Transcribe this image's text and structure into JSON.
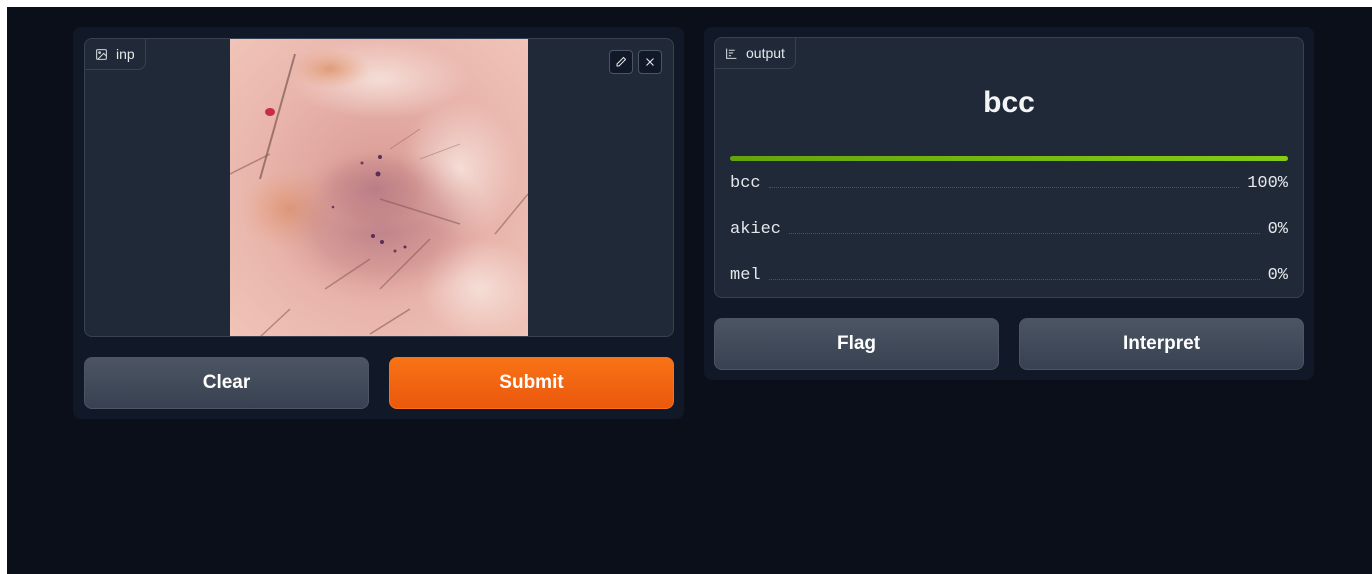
{
  "input_panel": {
    "label": "inp",
    "label_icon": "image-icon",
    "edit_icon": "pencil-icon",
    "close_icon": "close-icon",
    "image_alt": "dermoscopy skin lesion image"
  },
  "input_buttons": {
    "clear_label": "Clear",
    "submit_label": "Submit"
  },
  "output_panel": {
    "label": "output",
    "label_icon": "bar-chart-icon",
    "predicted_label": "bcc",
    "top_confidence": 1.0,
    "confidences": [
      {
        "label": "bcc",
        "value": "100%"
      },
      {
        "label": "akiec",
        "value": "0%"
      },
      {
        "label": "mel",
        "value": "0%"
      }
    ]
  },
  "output_buttons": {
    "flag_label": "Flag",
    "interpret_label": "Interpret"
  },
  "colors": {
    "background": "#0b0f19",
    "panel": "#111827",
    "block": "#1f2937",
    "primary": "#f97316",
    "bar": "#84cc16"
  }
}
